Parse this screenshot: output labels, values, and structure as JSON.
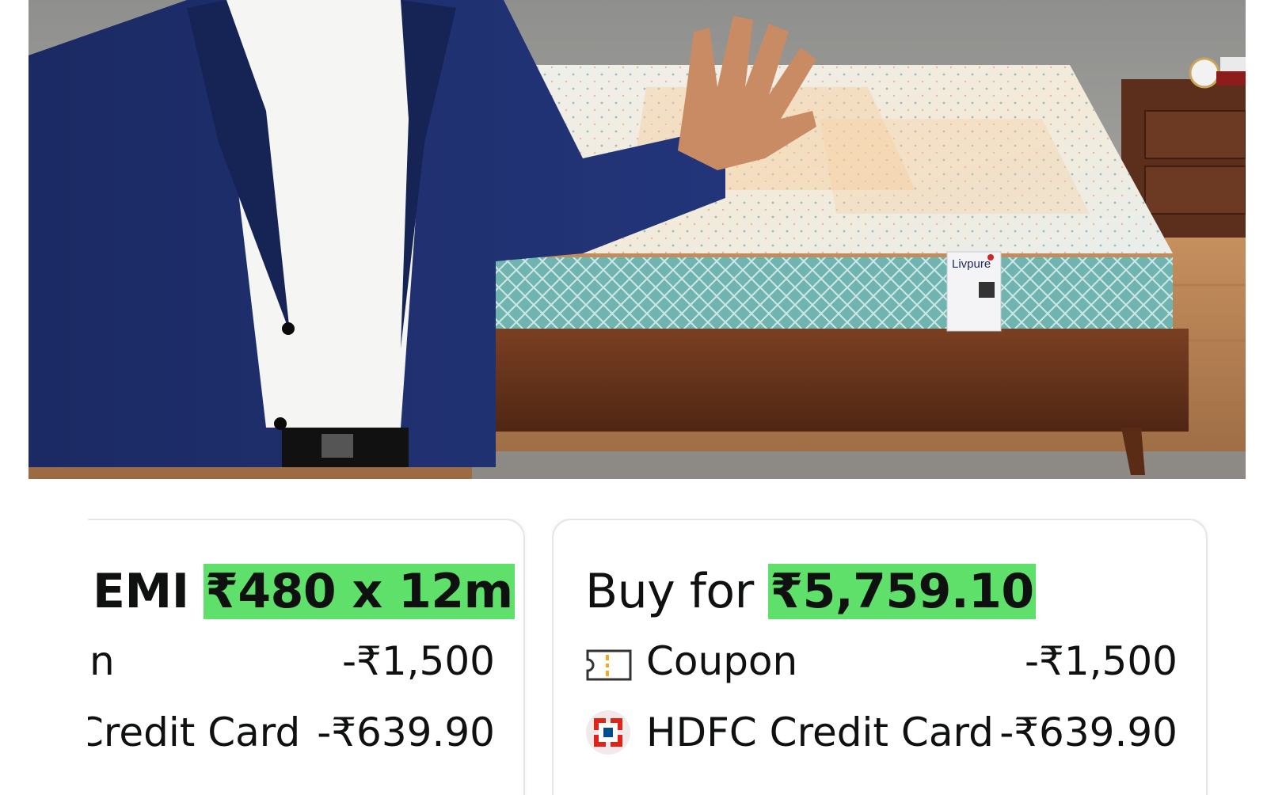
{
  "product_image": {
    "alt": "Livpure mattress with presenter",
    "brand_tag": "Livpure"
  },
  "emi_card": {
    "label": "EMI",
    "value": "₹480 x 12m",
    "rows": [
      {
        "label": "n",
        "amount": "-₹1,500"
      },
      {
        "label": "Credit Card",
        "amount": "-₹639.90"
      }
    ]
  },
  "buy_card": {
    "label": "Buy for",
    "value": "₹5,759.10",
    "rows": [
      {
        "icon": "coupon-icon",
        "label": "Coupon",
        "amount": "-₹1,500"
      },
      {
        "icon": "hdfc-bank-icon",
        "label": "HDFC Credit Card",
        "amount": "-₹639.90"
      }
    ]
  },
  "colors": {
    "highlight": "#5ee06a",
    "card_border": "#e6e6e6",
    "hdfc_red": "#e2231a",
    "hdfc_blue": "#004c8f",
    "coupon_orange": "#f7a823"
  }
}
